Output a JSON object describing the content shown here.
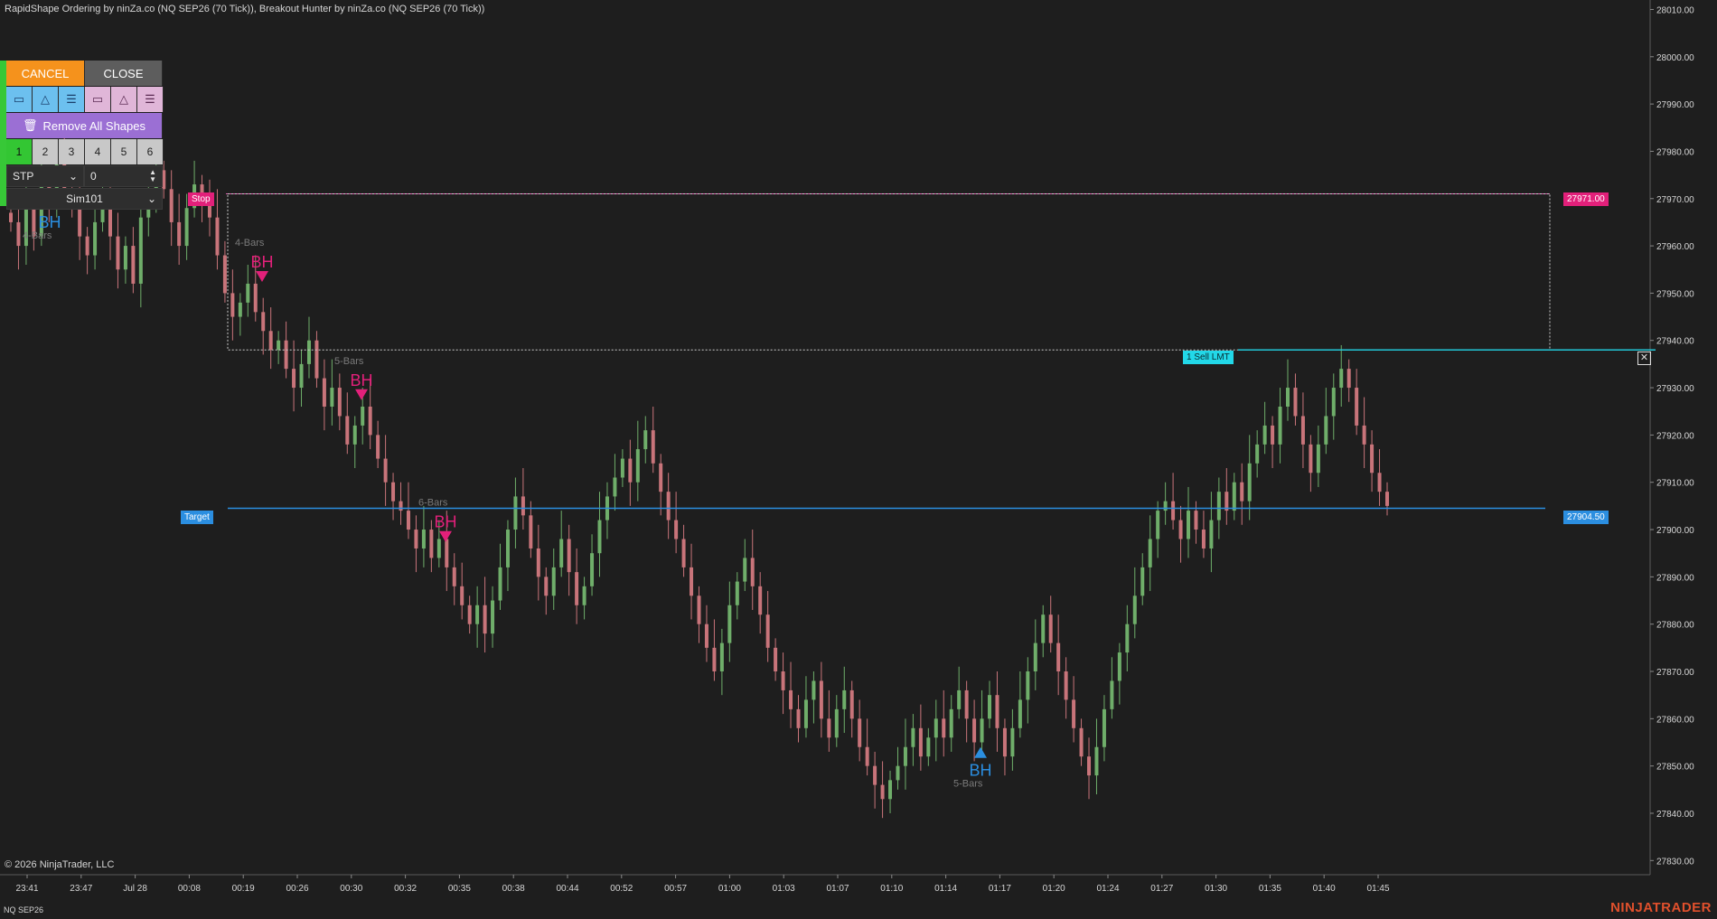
{
  "title": "RapidShape Ordering by ninZa.co (NQ SEP26 (70 Tick)), Breakout Hunter by ninZa.co (NQ SEP26 (70 Tick))",
  "copyright": "© 2026 NinjaTrader, LLC",
  "instrument": "NQ SEP26",
  "brand": "NINJATRADER",
  "panel": {
    "cancel_label": "CANCEL",
    "close_label": "CLOSE",
    "shape_icons": [
      "rectangle-icon",
      "triangle-icon",
      "lines-icon",
      "rectangle-icon",
      "triangle-icon",
      "lines-icon"
    ],
    "remove_label": "Remove All Shapes",
    "numbers": [
      "1",
      "2",
      "3",
      "4",
      "5",
      "6"
    ],
    "active_number": "1",
    "order_type": "STP",
    "offset_value": "0",
    "account": "Sim101"
  },
  "orders": {
    "stop_label": "Stop",
    "stop_price": "27971.00",
    "target_label": "Target",
    "target_price": "27904.50",
    "sell_label": "1  Sell LMT"
  },
  "colors": {
    "background": "#1e1e1e",
    "up_candle": "#6fae6a",
    "down_candle": "#c8747a",
    "bearish_signal": "#e2207a",
    "bullish_signal": "#2b8ee0",
    "target_line": "#2b8ee0",
    "limit_line": "#22c8d8",
    "stop_line": "#e060b0"
  },
  "chart_data": {
    "type": "candlestick",
    "y_ticks": [
      "28010.00",
      "28000.00",
      "27990.00",
      "27980.00",
      "27970.00",
      "27960.00",
      "27950.00",
      "27940.00",
      "27930.00",
      "27920.00",
      "27910.00",
      "27900.00",
      "27890.00",
      "27880.00",
      "27870.00",
      "27860.00",
      "27850.00",
      "27840.00",
      "27830.00"
    ],
    "x_ticks": [
      "23:41",
      "23:47",
      "Jul 28",
      "00:08",
      "00:19",
      "00:26",
      "00:30",
      "00:32",
      "00:35",
      "00:38",
      "00:44",
      "00:52",
      "00:57",
      "01:00",
      "01:03",
      "01:07",
      "01:10",
      "01:14",
      "01:17",
      "01:20",
      "01:24",
      "01:27",
      "01:30",
      "01:35",
      "01:40",
      "01:45"
    ],
    "ylim": [
      27827,
      28012
    ],
    "levels": {
      "stop": 27971.0,
      "sell_limit": 27938.0,
      "target": 27904.5
    },
    "signals": [
      {
        "text": "BH",
        "bars": "4-Bars",
        "direction": "down",
        "price": 27952
      },
      {
        "text": "BH",
        "bars": "5-Bars",
        "direction": "down",
        "price": 27927
      },
      {
        "text": "BH",
        "bars": "6-Bars",
        "direction": "down",
        "price": 27897
      },
      {
        "text": "BH",
        "bars": "5-Bars",
        "direction": "up",
        "price": 27854
      },
      {
        "text": "BH",
        "bars": "4-Bars",
        "direction": "up",
        "price": 27970
      }
    ],
    "closes": [
      27965,
      27960,
      27968,
      27962,
      27975,
      27970,
      27978,
      27972,
      27968,
      27962,
      27958,
      27965,
      27970,
      27962,
      27955,
      27960,
      27952,
      27966,
      27970,
      27976,
      27972,
      27965,
      27960,
      27968,
      27973,
      27970,
      27966,
      27958,
      27950,
      27945,
      27948,
      27952,
      27946,
      27942,
      27938,
      27940,
      27934,
      27930,
      27935,
      27940,
      27932,
      27926,
      27930,
      27924,
      27918,
      27922,
      27926,
      27920,
      27915,
      27910,
      27906,
      27904,
      27900,
      27896,
      27900,
      27894,
      27898,
      27892,
      27888,
      27884,
      27880,
      27884,
      27878,
      27885,
      27892,
      27900,
      27907,
      27903,
      27896,
      27890,
      27886,
      27892,
      27898,
      27891,
      27884,
      27888,
      27895,
      27902,
      27907,
      27911,
      27915,
      27910,
      27917,
      27921,
      27914,
      27908,
      27902,
      27898,
      27892,
      27886,
      27880,
      27875,
      27870,
      27876,
      27884,
      27889,
      27894,
      27888,
      27882,
      27875,
      27870,
      27866,
      27862,
      27858,
      27864,
      27868,
      27860,
      27856,
      27862,
      27866,
      27860,
      27854,
      27850,
      27846,
      27843,
      27847,
      27850,
      27854,
      27858,
      27852,
      27856,
      27860,
      27856,
      27862,
      27866,
      27860,
      27855,
      27860,
      27865,
      27858,
      27852,
      27858,
      27864,
      27870,
      27876,
      27882,
      27876,
      27870,
      27864,
      27858,
      27852,
      27848,
      27854,
      27862,
      27868,
      27874,
      27880,
      27886,
      27892,
      27898,
      27904,
      27906,
      27902,
      27898,
      27904,
      27900,
      27896,
      27902,
      27908,
      27904,
      27910,
      27906,
      27914,
      27918,
      27922,
      27918,
      27926,
      27930,
      27924,
      27918,
      27912,
      27918,
      27924,
      27930,
      27934,
      27930,
      27922,
      27918,
      27912,
      27908,
      27905
    ]
  }
}
